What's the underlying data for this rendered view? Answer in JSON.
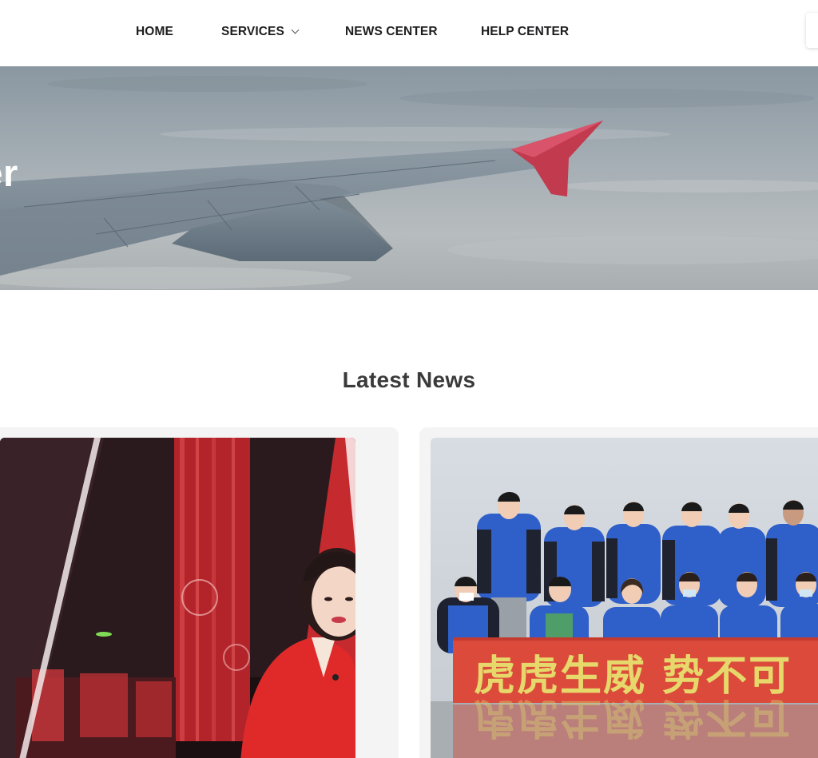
{
  "nav": {
    "items": [
      {
        "label": "HOME"
      },
      {
        "label": "SERVICES",
        "has_dropdown": true
      },
      {
        "label": "NEWS CENTER"
      },
      {
        "label": "HELP CENTER"
      }
    ]
  },
  "hero": {
    "title": "nter",
    "image": "airplane-wing-above-clouds"
  },
  "latest_news": {
    "title": "Latest News",
    "cards": [
      {
        "image": "news-anchor-in-red-studio"
      },
      {
        "image": "team-group-photo-with-banner",
        "banner_text": "虎虎生威 势不可"
      }
    ]
  },
  "colors": {
    "nav_text": "#1d1d1f",
    "hero_title": "#ffffff",
    "section_title": "#3a3a3a",
    "card_bg": "#f4f4f4",
    "banner_red": "#dc4a3c",
    "banner_text": "#e6d86a",
    "jacket_blue": "#2f5fc9"
  }
}
